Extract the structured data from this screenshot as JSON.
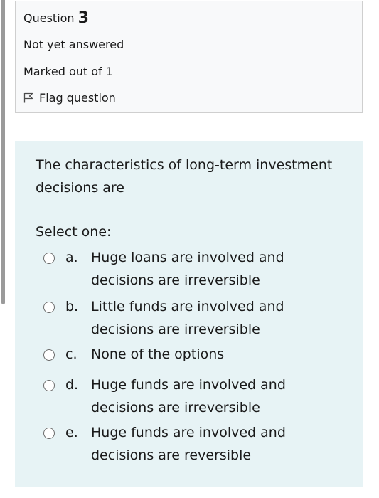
{
  "info": {
    "question_label": "Question",
    "question_number": "3",
    "state": "Not yet answered",
    "grade": "Marked out of 1",
    "flag_label": "Flag question"
  },
  "question": {
    "text": "The characteristics of long-term investment decisions are",
    "prompt": "Select one:",
    "options": [
      {
        "letter": "a.",
        "text": "Huge loans are involved and decisions are irreversible",
        "selected": false
      },
      {
        "letter": "b.",
        "text": "Little funds are involved and decisions are irreversible",
        "selected": false
      },
      {
        "letter": "c.",
        "text": "None of the options",
        "selected": false
      },
      {
        "letter": "d.",
        "text": "Huge funds are involved and decisions are irreversible",
        "selected": false
      },
      {
        "letter": "e.",
        "text": "Huge funds are involved and decisions are reversible",
        "selected": false
      }
    ]
  },
  "colors": {
    "info_background": "#f8f9fa",
    "content_background": "#e7f3f5",
    "border": "#cfcfcf",
    "scroll_indicator": "#9a9a9a"
  },
  "icons": {
    "flag": "flag-icon",
    "radio": "radio-unchecked-icon"
  }
}
